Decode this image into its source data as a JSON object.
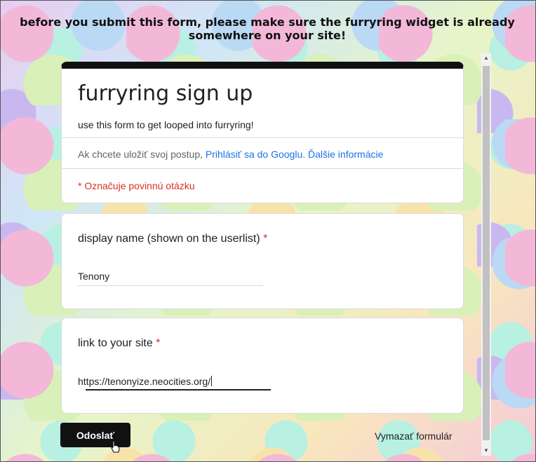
{
  "banner": "before you submit this form, please make sure the furryring widget is already somewhere on your site!",
  "form": {
    "title": "furryring sign up",
    "description": "use this form to get looped into furryring!",
    "signin_prefix": "Ak chcete uložiť svoj postup,",
    "signin_link": "Prihlásiť sa do Googlu.",
    "more_info_link": "Ďalšie informácie",
    "required_note": "* Označuje povinnú otázku"
  },
  "questions": [
    {
      "label": "display name (shown on the userlist)",
      "required_mark": "*",
      "value": "Tenony"
    },
    {
      "label": "link to your site",
      "required_mark": "*",
      "value": "https://tenonyize.neocities.org/"
    }
  ],
  "actions": {
    "submit_label": "Odoslať",
    "clear_label": "Vymazať formulár"
  },
  "colors": {
    "accent": "#111111",
    "link": "#1a73e8",
    "required": "#d93025"
  }
}
